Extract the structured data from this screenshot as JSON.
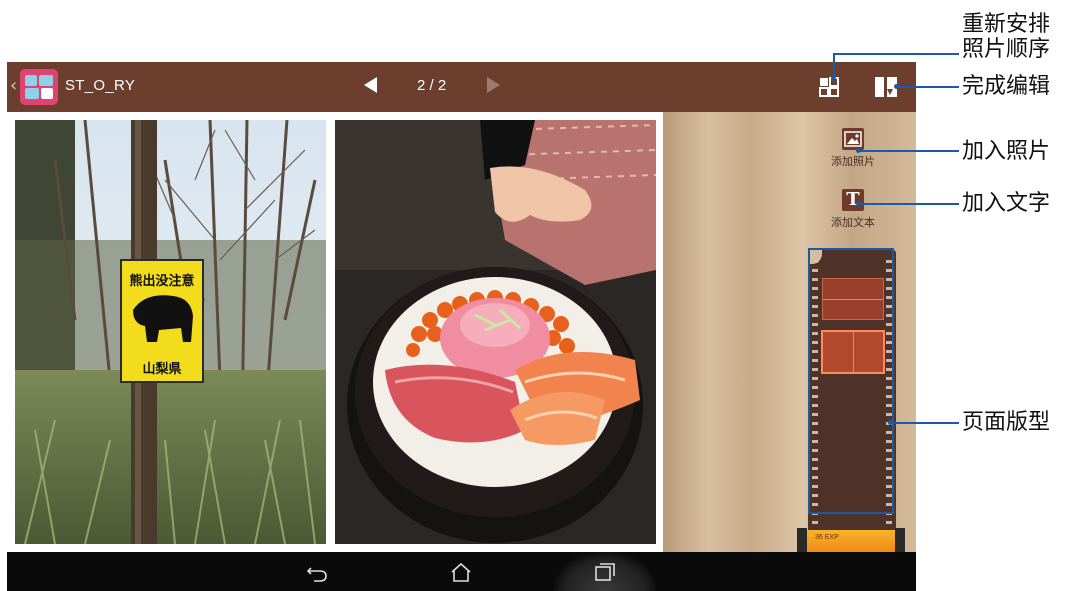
{
  "app": {
    "title": "ST_O_RY",
    "back_glyph": "‹",
    "page_indicator": "2 / 2"
  },
  "toolbar": {
    "prev_icon": "triangle-left-icon",
    "next_icon": "triangle-right-icon",
    "rearrange_icon": "grid-rearrange-icon",
    "finish_icon": "finish-edit-icon"
  },
  "side_panel": {
    "add_photo_label": "添加照片",
    "add_text_label": "添加文本",
    "add_text_glyph": "T",
    "film_label": "36 EXP"
  },
  "annotations": {
    "rearrange_photos": "重新安排\n照片顺序",
    "rearrange_line1": "重新安排",
    "rearrange_line2": "照片顺序",
    "finish_editing": "完成编辑",
    "add_photo": "加入照片",
    "add_text": "加入文字",
    "page_layout": "页面版型"
  },
  "photos": {
    "sign_title": "熊出没注意",
    "sign_footer": "山梨県"
  },
  "colors": {
    "topbar": "#6b3e2e",
    "app_icon": "#e0436f",
    "callout_line": "#1c5aa8",
    "navbar": "#0a0a0a",
    "sign_yellow": "#f2dc1c"
  }
}
